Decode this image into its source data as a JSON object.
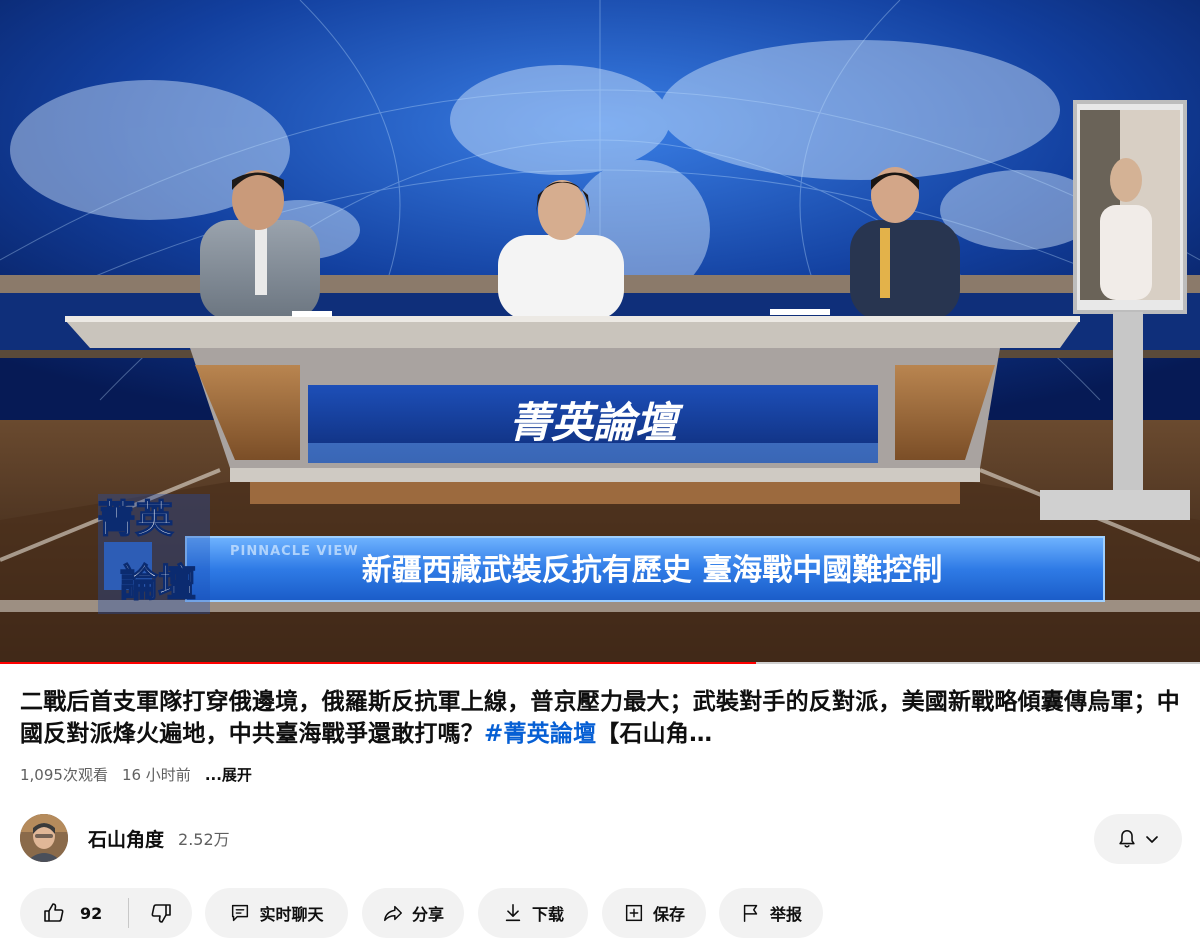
{
  "video": {
    "show_logo": "菁英論壇",
    "desk_logo": "菁英論壇",
    "watermark": "PINNACLE VIEW",
    "lower_third": "新疆西藏武裝反抗有歷史 臺海戰中國難控制",
    "progress_fraction": 0.63
  },
  "title": {
    "text": "二戰后首支軍隊打穿俄邊境，俄羅斯反抗軍上線，普京壓力最大；武裝對手的反對派，美國新戰略傾囊傳烏軍；中國反對派烽火遍地，中共臺海戰爭還敢打嗎？",
    "hashtag": "#菁英論壇",
    "tail": "【石山角…"
  },
  "meta": {
    "views": "1,095次观看",
    "time": "16 小时前",
    "more": "...展开"
  },
  "channel": {
    "name": "石山角度",
    "subscribers": "2.52万"
  },
  "actions": {
    "like_count": "92",
    "live_chat": "实时聊天",
    "share": "分享",
    "download": "下载",
    "save": "保存",
    "report": "举报"
  },
  "icons": [
    "bell-icon",
    "chevron-down-icon",
    "thumb-up-icon",
    "thumb-down-icon",
    "chat-icon",
    "share-icon",
    "download-icon",
    "save-icon",
    "flag-icon"
  ]
}
